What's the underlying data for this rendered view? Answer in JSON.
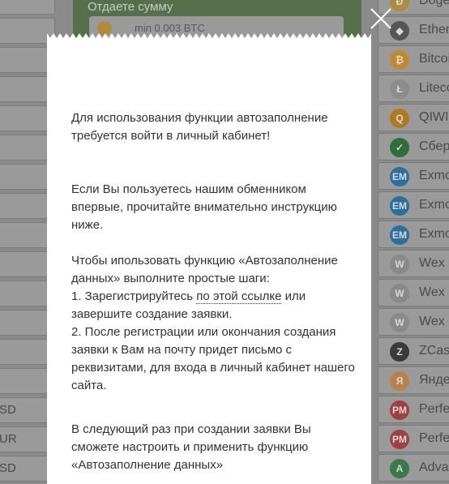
{
  "background": {
    "exchange_panel": {
      "label": "Отдаете сумму",
      "min_amount": "min 0.003 BTC"
    },
    "left_items": [
      "",
      "",
      "",
      "",
      "",
      "",
      "",
      "",
      "",
      "",
      "",
      "",
      "",
      "",
      "SD",
      "UR",
      "SD"
    ],
    "right_items": [
      {
        "name": "Doge",
        "icon": "dogecoin-icon",
        "color": "#b08b3c",
        "glyph": "Ð"
      },
      {
        "name": "Ether",
        "icon": "ethereum-icon",
        "color": "#555555",
        "glyph": "◆"
      },
      {
        "name": "Bitcoi",
        "icon": "bitcoin-icon",
        "color": "#c08a30",
        "glyph": "₿"
      },
      {
        "name": "Liteco",
        "icon": "litecoin-icon",
        "color": "#8c8c8c",
        "glyph": "Ł"
      },
      {
        "name": "QIWI",
        "icon": "qiwi-icon",
        "color": "#b07a20",
        "glyph": "Q"
      },
      {
        "name": "Сбер",
        "icon": "sberbank-icon",
        "color": "#2e6e3a",
        "glyph": "✓"
      },
      {
        "name": "Exmo",
        "icon": "exmo-icon",
        "color": "#2a6f9e",
        "glyph": "EM"
      },
      {
        "name": "Exmo",
        "icon": "exmo-icon",
        "color": "#2a6f9e",
        "glyph": "EM"
      },
      {
        "name": "Exmo",
        "icon": "exmo-icon",
        "color": "#2a6f9e",
        "glyph": "EM"
      },
      {
        "name": "Wex",
        "icon": "wex-icon",
        "color": "#8a8a8a",
        "glyph": "W"
      },
      {
        "name": "Wex",
        "icon": "wex-icon",
        "color": "#8a8a8a",
        "glyph": "W"
      },
      {
        "name": "Wex",
        "icon": "wex-icon",
        "color": "#8a8a8a",
        "glyph": "W"
      },
      {
        "name": "ZCas",
        "icon": "zcash-icon",
        "color": "#3a3a3a",
        "glyph": "Z"
      },
      {
        "name": "Янде",
        "icon": "yandex-money-icon",
        "color": "#b8834a",
        "glyph": "Я"
      },
      {
        "name": "Perfe",
        "icon": "perfect-money-icon",
        "color": "#a04040",
        "glyph": "PM"
      },
      {
        "name": "Perfe",
        "icon": "perfect-money-icon",
        "color": "#a04040",
        "glyph": "PM"
      },
      {
        "name": "Adva",
        "icon": "advcash-icon",
        "color": "#3a7a4a",
        "glyph": "A"
      }
    ]
  },
  "modal": {
    "p1": "Для использования функции автозаполнение требуется войти в личный кабинет!",
    "p2": "Если Вы пользуетесь нашим обменником впервые, прочитайте внимательно инструкцию ниже.",
    "p3_intro": "Чтобы ипользовать функцию «Автозаполнение данных» выполните простые шаги:",
    "step1_before": "1. Зарегистрируйтесь ",
    "step1_link": "по этой ссылке",
    "step1_after": " или завершите создание заявки.",
    "step2": "2. После регистрации или окончания создания заявки к Вам на почту придет письмо с реквизитами, для входа в личный кабинет нашего сайта.",
    "p4": "В следующий раз при создании заявки Вы сможете настроить и применить функцию «Автозаполнение данных»"
  },
  "colors": {
    "overlay": "#8a8a8a",
    "modal_bg": "#ffffff",
    "panel_green": "#55704a",
    "text": "#333333"
  }
}
